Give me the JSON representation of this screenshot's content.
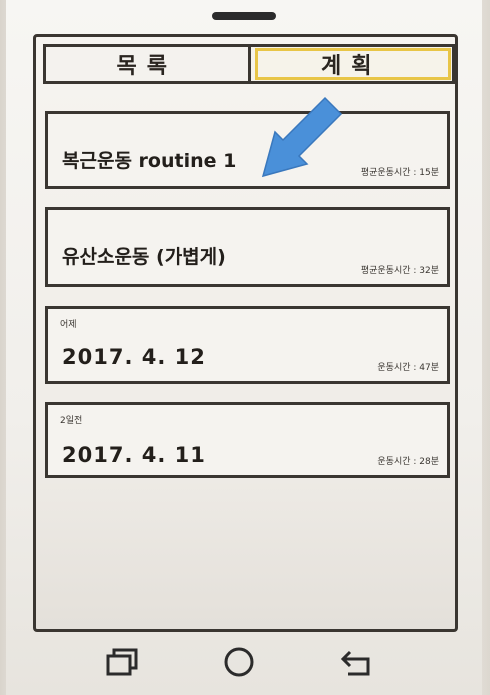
{
  "tabs": [
    {
      "label": "목록",
      "active": false
    },
    {
      "label": "계획",
      "active": true
    }
  ],
  "cards": [
    {
      "tag": "",
      "title": "복근운동 routine 1",
      "sub": "평균운동시간 : 15분"
    },
    {
      "tag": "",
      "title": "유산소운동 (가볍게)",
      "sub": "평균운동시간 : 32분"
    },
    {
      "tag": "어제",
      "title": "2017. 4. 12",
      "sub": "운동시간 : 47분"
    },
    {
      "tag": "2일전",
      "title": "2017. 4. 11",
      "sub": "운동시간 : 28분"
    }
  ],
  "annotation": {
    "icon": "arrow-icon",
    "color": "#4a90d9"
  },
  "navbar": {
    "recent_icon": "recent-apps-icon",
    "home_icon": "home-icon",
    "back_icon": "back-icon"
  },
  "colors": {
    "active_tab_outline": "#e8c547",
    "ink": "#3a3631"
  }
}
